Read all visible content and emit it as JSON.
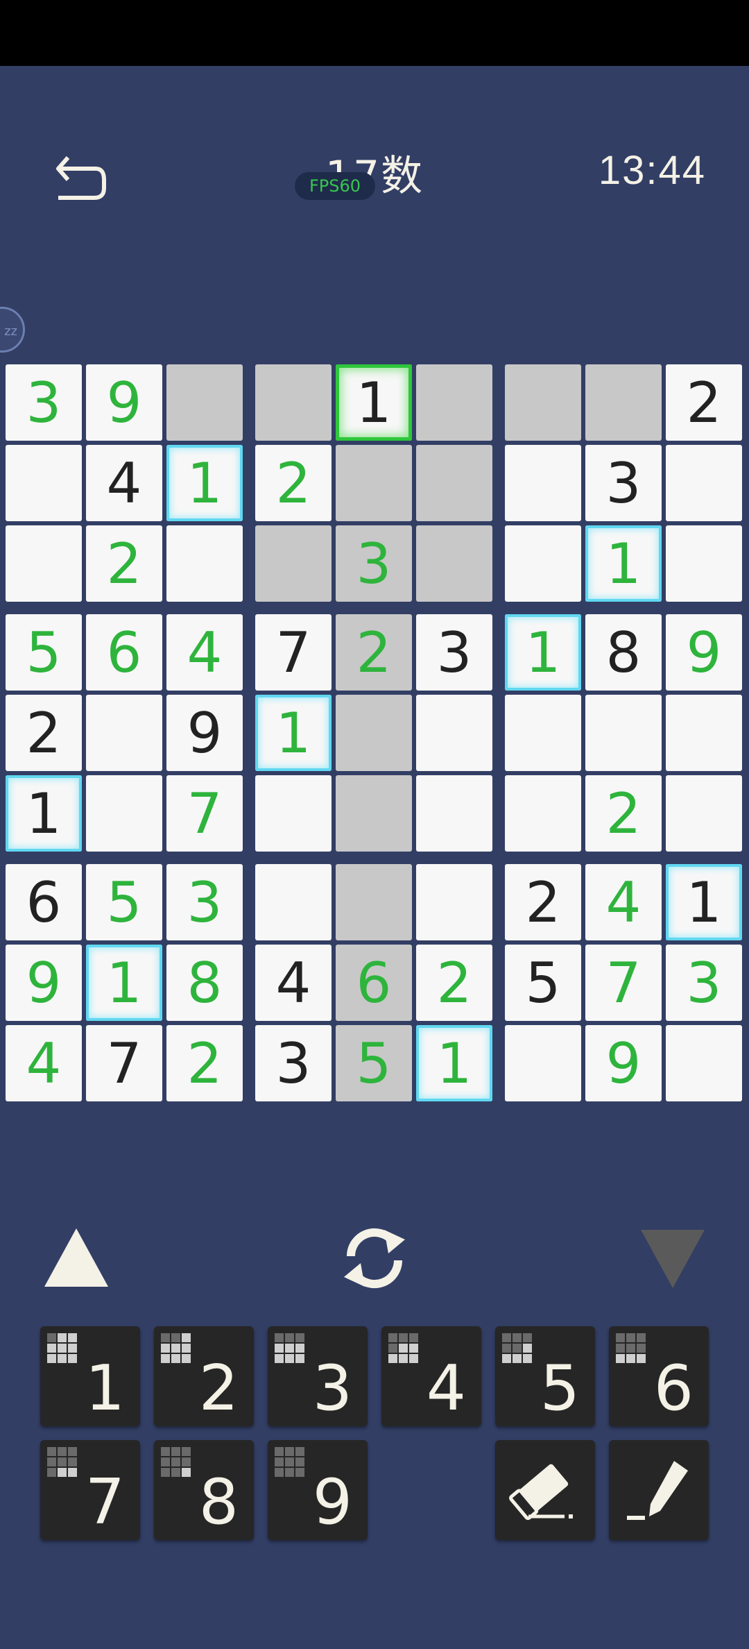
{
  "header": {
    "title": "17数",
    "fps_label": "FPS60",
    "timer": "13:44",
    "side_bubble_label": "zz"
  },
  "board": {
    "rows": [
      [
        "3",
        "9",
        "",
        "",
        "1",
        "",
        "",
        "",
        "2"
      ],
      [
        "",
        "4",
        "1",
        "2",
        "",
        "",
        "",
        "3",
        ""
      ],
      [
        "",
        "2",
        "",
        "",
        "3",
        "",
        "",
        "1",
        ""
      ],
      [
        "5",
        "6",
        "4",
        "7",
        "2",
        "3",
        "1",
        "8",
        "9"
      ],
      [
        "2",
        "",
        "9",
        "1",
        "",
        "",
        "",
        "",
        ""
      ],
      [
        "1",
        "",
        "7",
        "",
        "",
        "",
        "",
        "2",
        ""
      ],
      [
        "6",
        "5",
        "3",
        "",
        "",
        "",
        "2",
        "4",
        "1"
      ],
      [
        "9",
        "1",
        "8",
        "4",
        "6",
        "2",
        "5",
        "7",
        "3"
      ],
      [
        "4",
        "7",
        "2",
        "3",
        "5",
        "1",
        "",
        "9",
        ""
      ]
    ],
    "given": [
      [
        0,
        0,
        0,
        0,
        1,
        0,
        0,
        0,
        1
      ],
      [
        0,
        1,
        0,
        0,
        0,
        0,
        0,
        1,
        0
      ],
      [
        0,
        0,
        0,
        0,
        0,
        0,
        0,
        0,
        0
      ],
      [
        0,
        0,
        0,
        1,
        0,
        1,
        0,
        1,
        0
      ],
      [
        1,
        0,
        1,
        0,
        0,
        0,
        0,
        0,
        0
      ],
      [
        1,
        0,
        0,
        0,
        0,
        0,
        0,
        0,
        0
      ],
      [
        1,
        0,
        0,
        0,
        0,
        0,
        1,
        0,
        1
      ],
      [
        0,
        0,
        0,
        1,
        0,
        0,
        1,
        0,
        0
      ],
      [
        0,
        1,
        0,
        1,
        0,
        0,
        0,
        0,
        0
      ]
    ],
    "selected_cell": {
      "row": 0,
      "col": 4
    },
    "highlighted_digit": "1",
    "colors": {
      "given_digit": "#222222",
      "entered_digit": "#2eb43c",
      "cell": "#f7f7f7",
      "highlight": "#c8c8c8",
      "same_digit_glow": "#61d7f0",
      "selected_border": "#2ec63b"
    }
  },
  "controls": {
    "up_icon": "triangle-up-icon",
    "rotate_icon": "refresh-icon",
    "down_icon": "triangle-down-icon"
  },
  "keypad": {
    "keys": [
      {
        "label": "1",
        "progress": 1
      },
      {
        "label": "2",
        "progress": 2
      },
      {
        "label": "3",
        "progress": 3
      },
      {
        "label": "4",
        "progress": 4
      },
      {
        "label": "5",
        "progress": 5
      },
      {
        "label": "6",
        "progress": 6
      },
      {
        "label": "7",
        "progress": 7
      },
      {
        "label": "8",
        "progress": 8
      },
      {
        "label": "9",
        "progress": 9
      }
    ],
    "eraser_icon": "eraser-icon",
    "pencil_icon": "pencil-icon"
  }
}
